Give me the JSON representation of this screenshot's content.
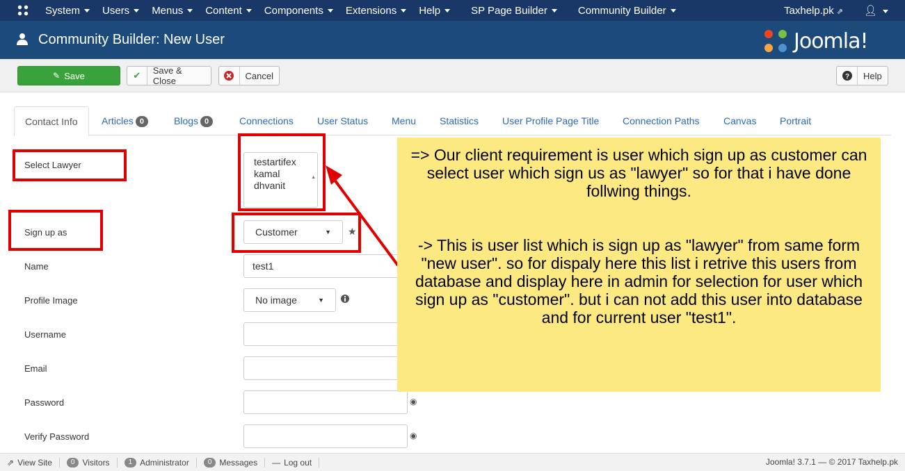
{
  "topbar": {
    "menu": [
      "System",
      "Users",
      "Menus",
      "Content",
      "Components",
      "Extensions",
      "Help",
      "SP Page Builder",
      "Community Builder"
    ],
    "site_link": "Taxhelp.pk"
  },
  "header": {
    "title": "Community Builder: New User",
    "brand": "Joomla!"
  },
  "toolbar": {
    "save": "Save",
    "save_close": "Save & Close",
    "cancel": "Cancel",
    "help": "Help"
  },
  "tabs": [
    {
      "label": "Contact Info"
    },
    {
      "label": "Articles",
      "badge": "0"
    },
    {
      "label": "Blogs",
      "badge": "0"
    },
    {
      "label": "Connections"
    },
    {
      "label": "User Status"
    },
    {
      "label": "Menu"
    },
    {
      "label": "Statistics"
    },
    {
      "label": "User Profile Page Title"
    },
    {
      "label": "Connection Paths"
    },
    {
      "label": "Canvas"
    },
    {
      "label": "Portrait"
    }
  ],
  "form": {
    "select_lawyer_label": "Select Lawyer",
    "lawyer_options": [
      "testartifex",
      "kamal",
      "dhvanit"
    ],
    "signup_label": "Sign up as",
    "signup_value": "Customer",
    "name_label": "Name",
    "name_value": "test1",
    "profile_image_label": "Profile Image",
    "profile_image_value": "No image",
    "username_label": "Username",
    "email_label": "Email",
    "password_label": "Password",
    "verify_password_label": "Verify Password"
  },
  "note": {
    "p1": "=> Our client requirement is user which sign up as customer can select user which sign us as \"lawyer\" so for that i have done follwing things.",
    "p2": "-> This is user list which is sign up as \"lawyer\" from same form \"new user\". so for dispaly here this list i retrive this users from database and display here in admin for selection for user which sign up as \"customer\". but i can not add this user into database and for current user \"test1\"."
  },
  "statusbar": {
    "view_site": "View Site",
    "visitors_count": "0",
    "visitors": "Visitors",
    "admin_count": "1",
    "admin": "Administrator",
    "messages_count": "0",
    "messages": "Messages",
    "logout": "Log out",
    "version": "Joomla! 3.7.1 — © 2017 Taxhelp.pk"
  },
  "colors": {
    "topbar": "#1a3867",
    "header": "#1c4a7b",
    "save": "#3aa23a",
    "annotation_red": "#e00000",
    "note_bg": "#fde982"
  }
}
